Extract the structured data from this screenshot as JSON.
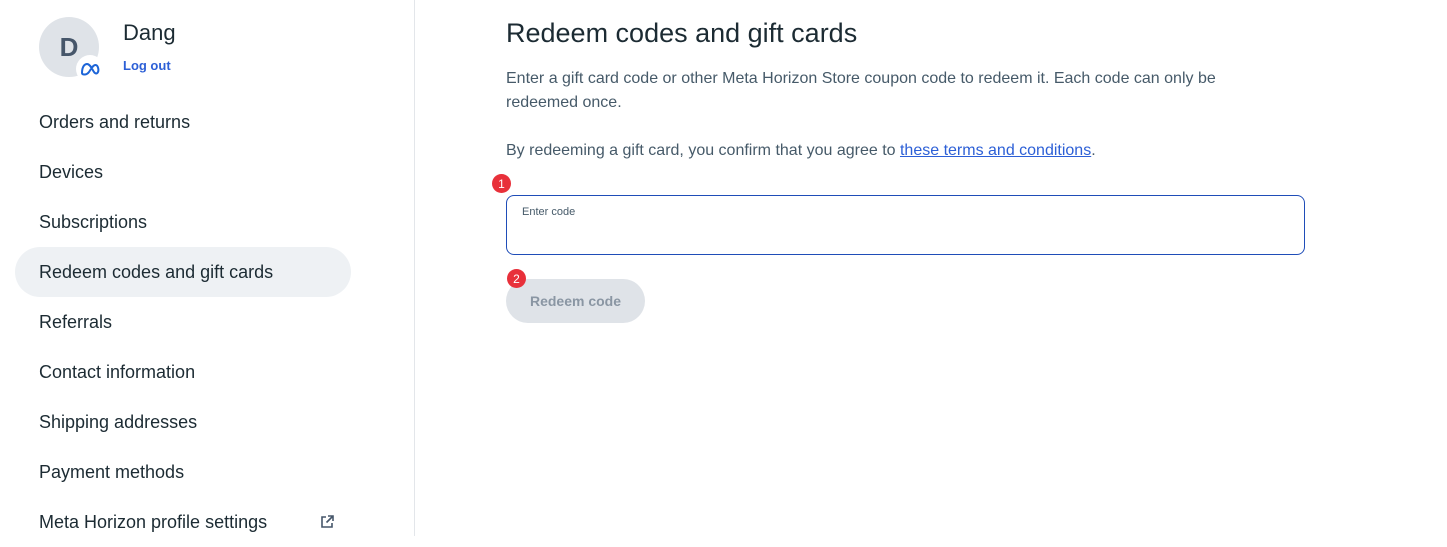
{
  "profile": {
    "avatar_initial": "D",
    "name": "Dang",
    "logout_label": "Log out"
  },
  "sidebar": {
    "items": [
      {
        "label": "Orders and returns"
      },
      {
        "label": "Devices"
      },
      {
        "label": "Subscriptions"
      },
      {
        "label": "Redeem codes and gift cards",
        "active": true
      },
      {
        "label": "Referrals"
      },
      {
        "label": "Contact information"
      },
      {
        "label": "Shipping addresses"
      },
      {
        "label": "Payment methods"
      },
      {
        "label": "Meta Horizon profile settings",
        "icon": "external-link-icon"
      }
    ]
  },
  "main": {
    "title": "Redeem codes and gift cards",
    "description": "Enter a gift card code or other Meta Horizon Store coupon code to redeem it. Each code can only be redeemed once.",
    "terms_prefix": "By redeeming a gift card, you confirm that you agree to ",
    "terms_link": "these terms and conditions",
    "terms_suffix": ".",
    "code_field_label": "Enter code",
    "code_value": "",
    "redeem_button": "Redeem code"
  },
  "markers": [
    "1",
    "2"
  ],
  "colors": {
    "accent": "#2c5fd6",
    "input_border": "#1f4db8",
    "active_nav": "#eef1f4",
    "marker": "#e8303a",
    "button_disabled": "#dfe3e8"
  }
}
